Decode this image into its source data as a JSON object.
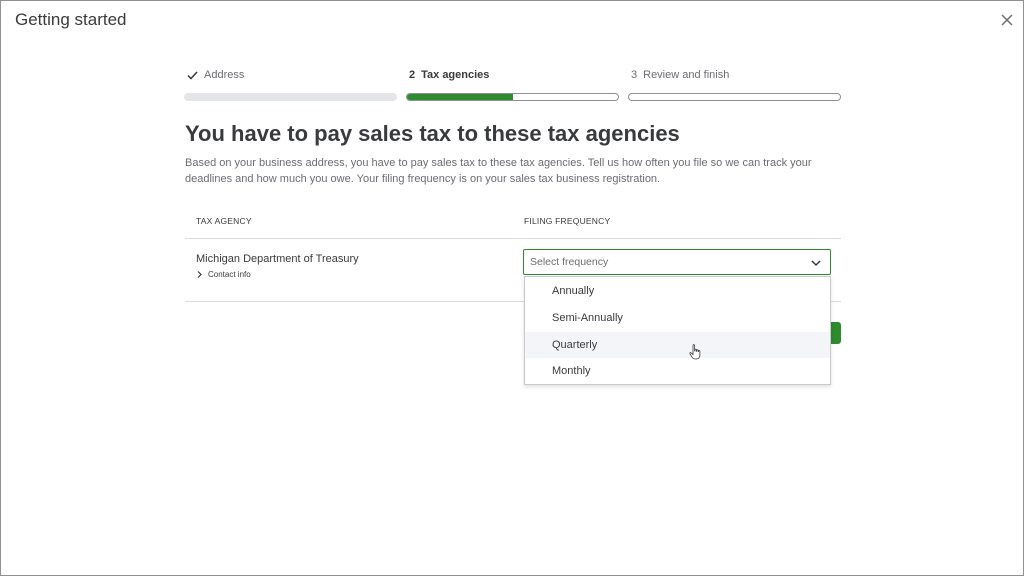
{
  "dialog": {
    "title": "Getting started"
  },
  "icons": {
    "close": "close-icon",
    "check": "check-icon",
    "chevron_right": "chevron-right-icon",
    "chevron_down": "chevron-down-icon",
    "cursor": "hand-pointer-icon"
  },
  "colors": {
    "accent": "#2e8b2e",
    "text": "#393a3d",
    "muted": "#6b6c72",
    "border": "#8d9096"
  },
  "stepper": {
    "steps": [
      {
        "number": "",
        "label": "Address",
        "state": "completed",
        "progress": 1.0
      },
      {
        "number": "2",
        "label": "Tax agencies",
        "state": "active",
        "progress": 0.5
      },
      {
        "number": "3",
        "label": "Review and finish",
        "state": "upcoming",
        "progress": 0.0
      }
    ]
  },
  "main": {
    "heading": "You have to pay sales tax to these tax agencies",
    "description": "Based on your business address, you have to pay sales tax to these tax agencies. Tell us how often you file so we can track your deadlines and how much you owe. Your filing frequency is on your sales tax business registration."
  },
  "table": {
    "columns": [
      "TAX AGENCY",
      "FILING FREQUENCY"
    ],
    "rows": [
      {
        "agency": "Michigan Department of Treasury",
        "contact_link": "Contact info",
        "frequency_placeholder": "Select frequency"
      }
    ]
  },
  "frequency_dropdown": {
    "open": true,
    "hovered_index": 2,
    "options": [
      "Annually",
      "Semi-Annually",
      "Quarterly",
      "Monthly"
    ]
  }
}
